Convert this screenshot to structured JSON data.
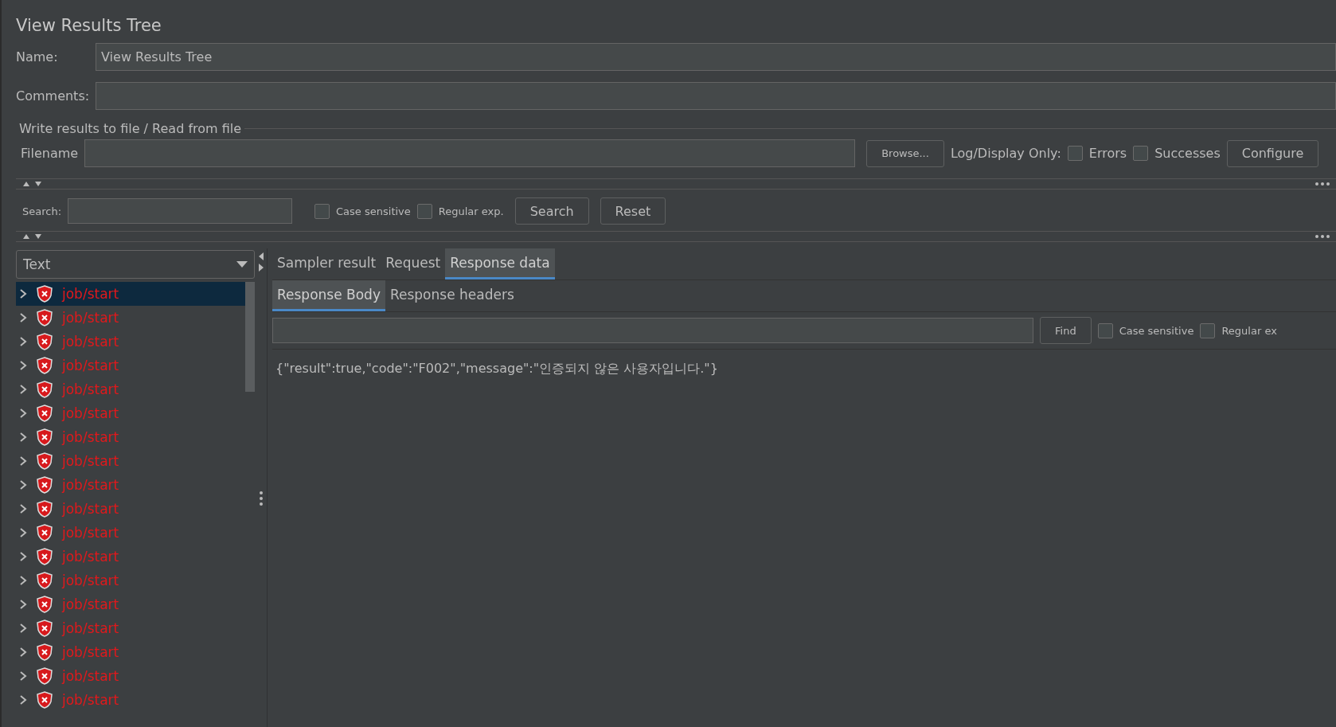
{
  "title": "View Results Tree",
  "name_field": {
    "label": "Name:",
    "value": "View Results Tree"
  },
  "comments_field": {
    "label": "Comments:"
  },
  "file_group": {
    "title": "Write results to file / Read from file",
    "filename_label": "Filename",
    "browse": "Browse...",
    "log_label": "Log/Display Only:",
    "checks": [
      {
        "label": "Errors",
        "checked": false
      },
      {
        "label": "Successes",
        "checked": false
      }
    ],
    "configure": "Configure"
  },
  "search_bar": {
    "label": "Search:",
    "checks": [
      {
        "label": "Case sensitive",
        "checked": false
      },
      {
        "label": "Regular exp.",
        "checked": false
      }
    ],
    "buttons": [
      "Search",
      "Reset"
    ]
  },
  "renderer": {
    "value": "Text"
  },
  "tree": [
    {
      "label": "job/start",
      "failed": true,
      "selected": true
    },
    {
      "label": "job/start",
      "failed": true,
      "selected": false
    },
    {
      "label": "job/start",
      "failed": true,
      "selected": false
    },
    {
      "label": "job/start",
      "failed": true,
      "selected": false
    },
    {
      "label": "job/start",
      "failed": true,
      "selected": false
    },
    {
      "label": "job/start",
      "failed": true,
      "selected": false
    },
    {
      "label": "job/start",
      "failed": true,
      "selected": false
    },
    {
      "label": "job/start",
      "failed": true,
      "selected": false
    },
    {
      "label": "job/start",
      "failed": true,
      "selected": false
    },
    {
      "label": "job/start",
      "failed": true,
      "selected": false
    },
    {
      "label": "job/start",
      "failed": true,
      "selected": false
    },
    {
      "label": "job/start",
      "failed": true,
      "selected": false
    },
    {
      "label": "job/start",
      "failed": true,
      "selected": false
    },
    {
      "label": "job/start",
      "failed": true,
      "selected": false
    },
    {
      "label": "job/start",
      "failed": true,
      "selected": false
    },
    {
      "label": "job/start",
      "failed": true,
      "selected": false
    },
    {
      "label": "job/start",
      "failed": true,
      "selected": false
    },
    {
      "label": "job/start",
      "failed": true,
      "selected": false
    }
  ],
  "tabs": [
    {
      "label": "Sampler result",
      "selected": false
    },
    {
      "label": "Request",
      "selected": false
    },
    {
      "label": "Response data",
      "selected": true
    }
  ],
  "sub_tabs": [
    {
      "label": "Response Body",
      "selected": true
    },
    {
      "label": "Response headers",
      "selected": false
    }
  ],
  "find_bar": {
    "button": "Find",
    "checks": [
      {
        "label": "Case sensitive",
        "checked": false
      },
      {
        "label": "Regular ex",
        "checked": false
      }
    ]
  },
  "response_text": "{\"result\":true,\"code\":\"F002\",\"message\":\"인증되지 않은 사용자입니다.\"}"
}
